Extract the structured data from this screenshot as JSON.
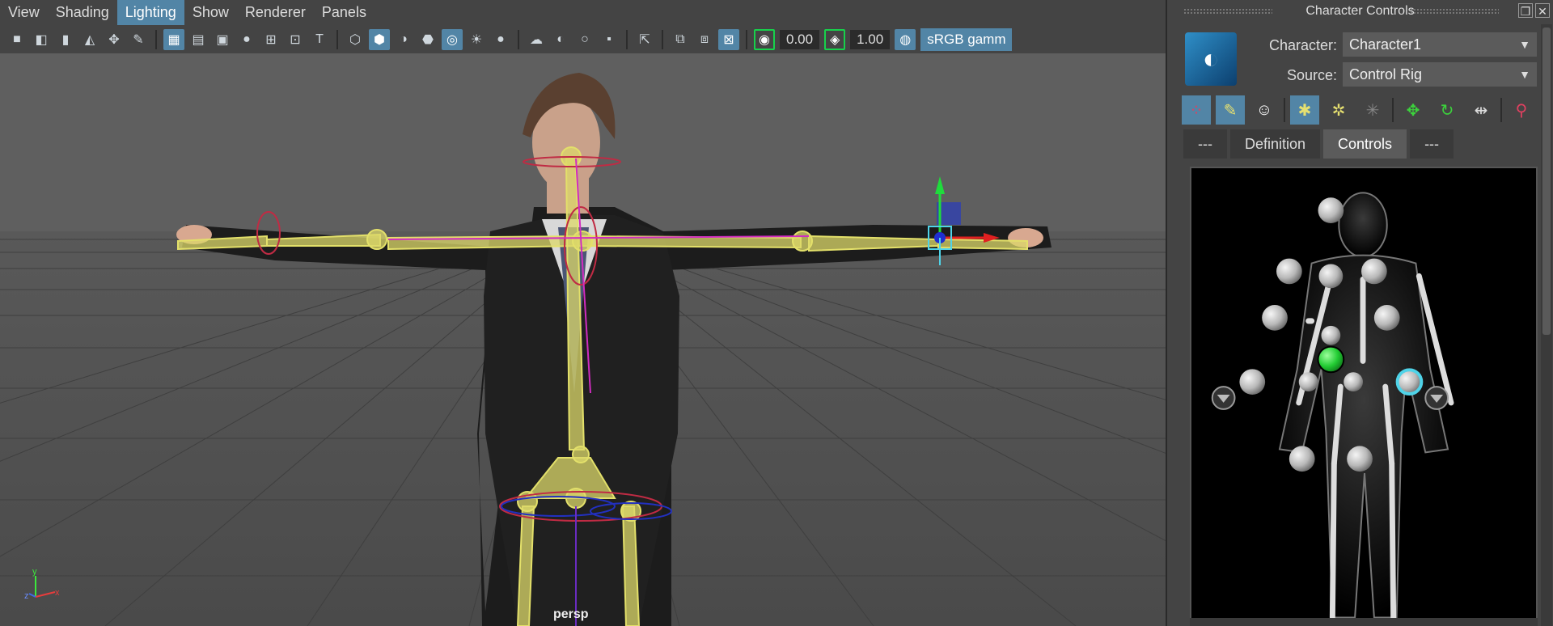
{
  "menubar": {
    "items": [
      "View",
      "Shading",
      "Lighting",
      "Show",
      "Renderer",
      "Panels"
    ],
    "active": "Lighting"
  },
  "toolbar": {
    "exposure_value": "0.00",
    "gamma_value": "1.00",
    "colorspace": "sRGB gamm"
  },
  "viewport": {
    "camera_label": "persp",
    "axis_x": "x",
    "axis_y": "y",
    "axis_z": "z"
  },
  "character_controls": {
    "title": "Character Controls",
    "character_label": "Character:",
    "character_value": "Character1",
    "source_label": "Source:",
    "source_value": "Control Rig",
    "tabs": [
      {
        "label": "---",
        "active": false
      },
      {
        "label": "Definition",
        "active": false
      },
      {
        "label": "Controls",
        "active": true
      },
      {
        "label": "---",
        "active": false
      }
    ]
  },
  "icons": {
    "logo": "humanik-logo-icon",
    "minimize": "restore-window-icon",
    "close": "close-icon"
  },
  "colors": {
    "accent": "#5285a6",
    "active_effector": "#2ecc40",
    "selected_effector": "#4fd3e8",
    "skeleton": "#e3e06a"
  }
}
